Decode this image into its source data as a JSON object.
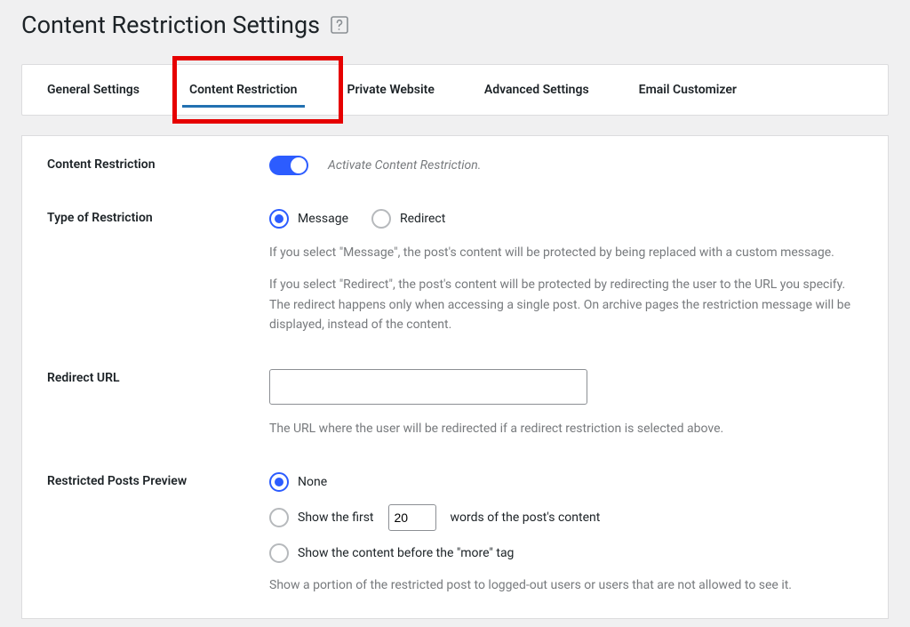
{
  "page": {
    "title": "Content Restriction Settings"
  },
  "tabs": {
    "general": "General Settings",
    "content": "Content Restriction",
    "private": "Private Website",
    "advanced": "Advanced Settings",
    "email": "Email Customizer"
  },
  "cr": {
    "label": "Content Restriction",
    "toggle_label": "Activate Content Restriction."
  },
  "type": {
    "label": "Type of Restriction",
    "message": "Message",
    "redirect": "Redirect",
    "desc1": "If you select \"Message\", the post's content will be protected by being replaced with a custom message.",
    "desc2": "If you select \"Redirect\", the post's content will be protected by redirecting the user to the URL you specify. The redirect happens only when accessing a single post. On archive pages the restriction message will be displayed, instead of the content."
  },
  "redirect": {
    "label": "Redirect URL",
    "value": "",
    "desc": "The URL where the user will be redirected if a redirect restriction is selected above."
  },
  "preview": {
    "label": "Restricted Posts Preview",
    "none": "None",
    "first_pre": "Show the first",
    "first_count": "20",
    "first_post": "words of the post's content",
    "more": "Show the content before the \"more\" tag",
    "desc": "Show a portion of the restricted post to logged-out users or users that are not allowed to see it."
  }
}
